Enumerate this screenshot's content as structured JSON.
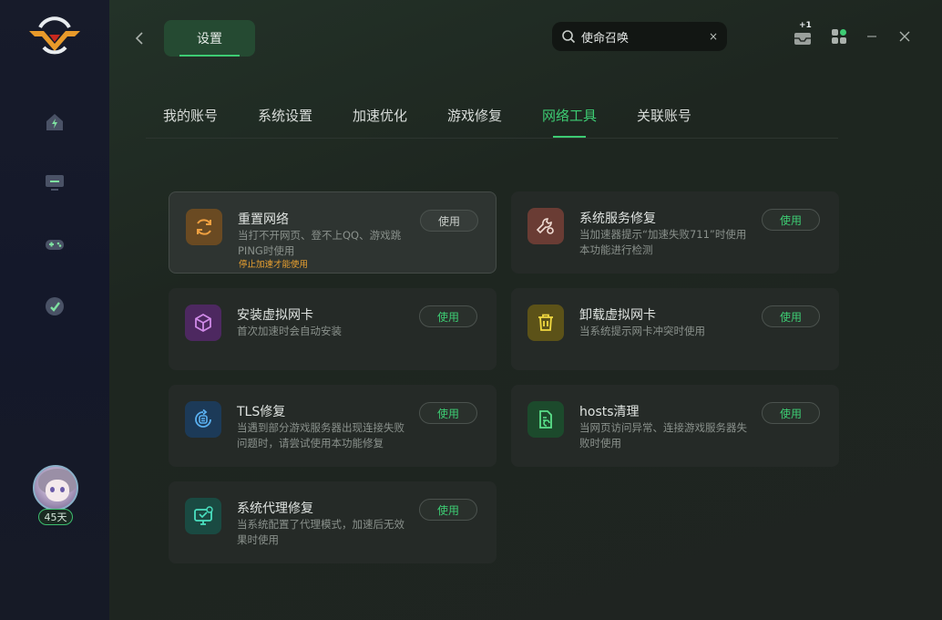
{
  "header": {
    "title": "设置",
    "search_value": "使命召唤",
    "search_clear": "×",
    "badge_plus": "+1"
  },
  "sidebar": {
    "nav": [
      "home-icon",
      "monitor-icon",
      "gamepad-icon",
      "speedometer-icon"
    ],
    "days_label": "45天"
  },
  "tabs": [
    {
      "label": "我的账号",
      "active": false
    },
    {
      "label": "系统设置",
      "active": false
    },
    {
      "label": "加速优化",
      "active": false
    },
    {
      "label": "游戏修复",
      "active": false
    },
    {
      "label": "网络工具",
      "active": true
    },
    {
      "label": "关联账号",
      "active": false
    }
  ],
  "tools": [
    {
      "name": "重置网络",
      "desc": "当打不开网页、登不上QQ、游戏跳PING时使用",
      "warn": "停止加速才能使用",
      "button": "使用",
      "icon": "refresh-icon",
      "color": "#e8882a",
      "bg": "#6a4a22"
    },
    {
      "name": "系统服务修复",
      "desc": "当加速器提示“加速失败711”时使用本功能进行检测",
      "button": "使用",
      "icon": "wrench-icon",
      "color": "#e6c9c0",
      "bg": "#6a3c34"
    },
    {
      "name": "安装虚拟网卡",
      "desc": "首次加速时会自动安装",
      "button": "使用",
      "icon": "cube-icon",
      "color": "#c47ae0",
      "bg": "#4d2860"
    },
    {
      "name": "卸载虚拟网卡",
      "desc": "当系统提示网卡冲突时使用",
      "button": "使用",
      "icon": "trash-icon",
      "color": "#e8c830",
      "bg": "#5c5218"
    },
    {
      "name": "TLS修复",
      "desc": "当遇到部分游戏服务器出现连接失败问题时，请尝试使用本功能修复",
      "button": "使用",
      "icon": "tls-repair-icon",
      "color": "#4aa0e8",
      "bg": "#1c3a58"
    },
    {
      "name": "hosts清理",
      "desc": "当网页访问异常、连接游戏服务器失败时使用",
      "button": "使用",
      "icon": "file-clean-icon",
      "color": "#4ad07a",
      "bg": "#1c4a2c"
    },
    {
      "name": "系统代理修复",
      "desc": "当系统配置了代理模式，加速后无效果时使用",
      "button": "使用",
      "icon": "monitor-repair-icon",
      "color": "#3ad0b0",
      "bg": "#1a4a42"
    }
  ]
}
